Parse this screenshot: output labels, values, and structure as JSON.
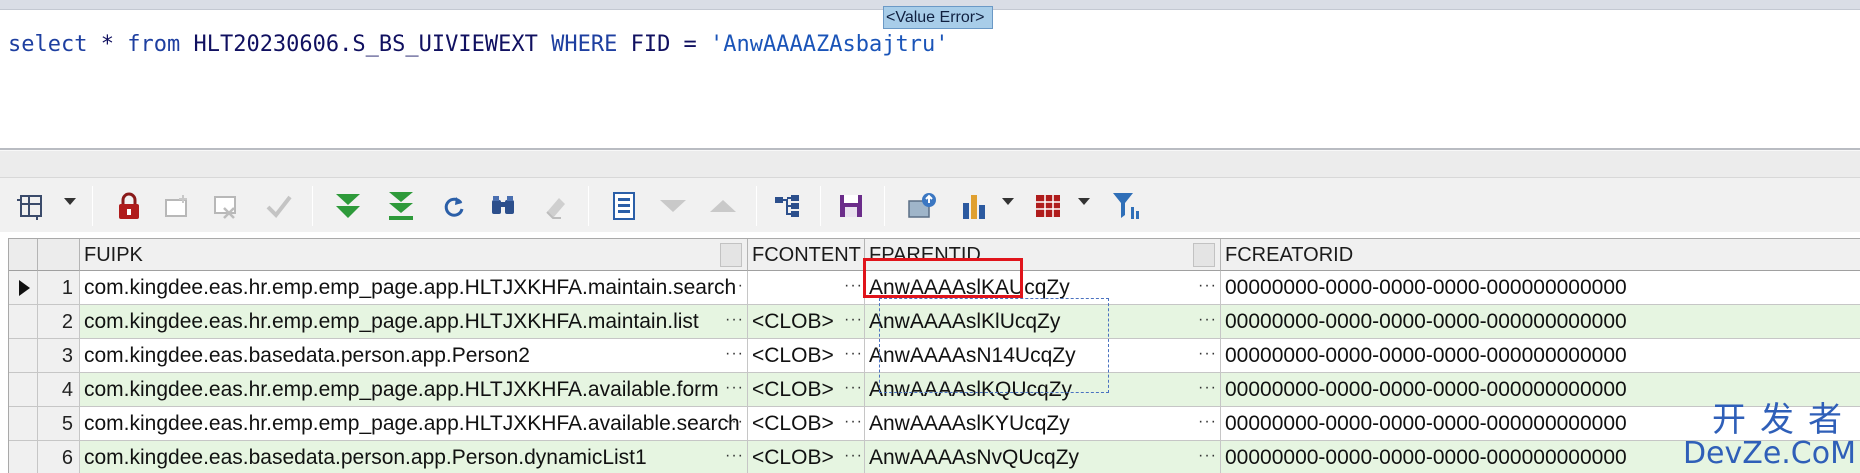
{
  "editor": {
    "sql_select": "select",
    "sql_star": " * ",
    "sql_from": "from",
    "sql_table": " HLT20230606.S_BS_UIVIEWEXT ",
    "sql_where": "WHERE",
    "sql_field": " FID = ",
    "sql_value": "'AnwAAAAZAsbajtru'"
  },
  "toolbar": {
    "icons": [
      "grid-options-icon",
      "lock-icon",
      "insert-record-icon",
      "delete-record-icon",
      "post-edit-icon",
      "fetch-next-icon",
      "fetch-all-icon",
      "refresh-icon",
      "find-icon",
      "clear-icon",
      "single-record-view-icon",
      "filter-down-icon",
      "filter-up-icon",
      "query-by-example-icon",
      "save-icon",
      "export-icon",
      "chart-icon",
      "table-view-icon",
      "column-filter-icon"
    ]
  },
  "grid": {
    "columns": [
      "FUIPK",
      "FCONTENT",
      "FPARENTID",
      "FCREATORID"
    ],
    "rows": [
      {
        "num": "1",
        "fuipk": "com.kingdee.eas.hr.emp.emp_page.app.HLTJXKHFA.maintain.search",
        "fcontent": "<Value Error>",
        "fparentid": "AnwAAAAslKAUcqZy",
        "fcreatorid": "00000000-0000-0000-0000-000000000000"
      },
      {
        "num": "2",
        "fuipk": "com.kingdee.eas.hr.emp.emp_page.app.HLTJXKHFA.maintain.list",
        "fcontent": "<CLOB>",
        "fparentid": "AnwAAAAslKlUcqZy",
        "fcreatorid": "00000000-0000-0000-0000-000000000000"
      },
      {
        "num": "3",
        "fuipk": "com.kingdee.eas.basedata.person.app.Person2",
        "fcontent": "<CLOB>",
        "fparentid": "AnwAAAAsN14UcqZy",
        "fcreatorid": "00000000-0000-0000-0000-000000000000"
      },
      {
        "num": "4",
        "fuipk": "com.kingdee.eas.hr.emp.emp_page.app.HLTJXKHFA.available.form",
        "fcontent": "<CLOB>",
        "fparentid": "AnwAAAAslKQUcqZy",
        "fcreatorid": "00000000-0000-0000-0000-000000000000"
      },
      {
        "num": "5",
        "fuipk": "com.kingdee.eas.hr.emp.emp_page.app.HLTJXKHFA.available.search",
        "fcontent": "<CLOB>",
        "fparentid": "AnwAAAAslKYUcqZy",
        "fcreatorid": "00000000-0000-0000-0000-000000000000"
      },
      {
        "num": "6",
        "fuipk": "com.kingdee.eas.basedata.person.app.Person.dynamicList1",
        "fcontent": "<CLOB>",
        "fparentid": "AnwAAAAsNvQUcqZy",
        "fcreatorid": "00000000-0000-0000-0000-000000000000"
      }
    ],
    "ellipsis": "···"
  },
  "watermark": {
    "line1": "开发者",
    "line2": "DevZe.CoM"
  }
}
